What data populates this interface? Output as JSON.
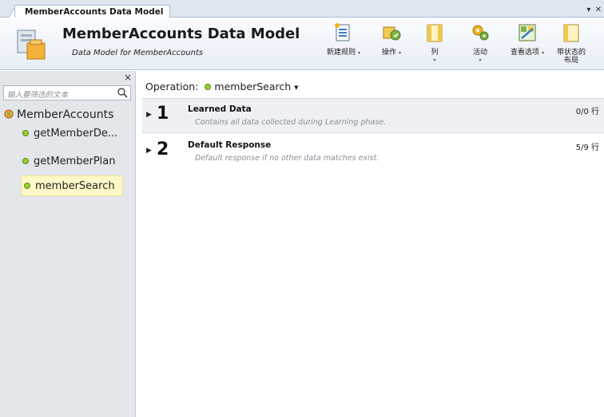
{
  "tab": {
    "label": "MemberAccounts Data Model",
    "controls": "▾ ✕"
  },
  "header": {
    "title": "MemberAccounts Data Model",
    "subtitle": "Data Model for MemberAccounts",
    "toolbar": [
      {
        "label": "新建规则",
        "dropdown": "▾",
        "icon": "new-rule-icon"
      },
      {
        "label": "操作",
        "dropdown": "▾",
        "icon": "actions-icon"
      },
      {
        "label": "列",
        "dropdown": "▾",
        "icon": "columns-icon"
      },
      {
        "label": "活动",
        "dropdown": "▾",
        "icon": "activity-icon"
      },
      {
        "label": "查看选项",
        "dropdown": "▾",
        "icon": "view-options-icon"
      },
      {
        "label": "带状态的布局",
        "icon": "stateful-layout-icon"
      }
    ]
  },
  "sidebar": {
    "close": "×",
    "filter_placeholder": "输入要筛选的文本",
    "root": "MemberAccounts",
    "items": [
      {
        "label": "getMemberDe..."
      },
      {
        "label": "getMemberPlan"
      },
      {
        "label": "memberSearch",
        "selected": true
      }
    ]
  },
  "main": {
    "operation_label": "Operation:",
    "operation_value": "memberSearch",
    "rules": [
      {
        "num": "1",
        "name": "Learned Data",
        "desc": "Contains all data collected during Learning phase.",
        "count": "0/0 行"
      },
      {
        "num": "2",
        "name": "Default Response",
        "desc": "Default response if no other data matches exist.",
        "count": "5/9 行"
      }
    ]
  },
  "colors": {
    "accent_dot": "#9acd32",
    "selected_bg": "#fff8c8",
    "rule_bg": "#eef0f3"
  }
}
